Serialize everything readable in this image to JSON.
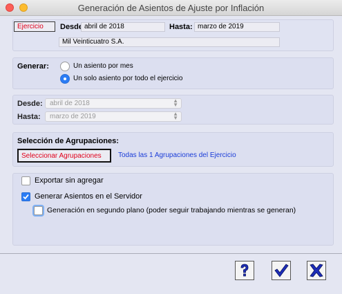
{
  "window": {
    "title": "Generación de Asientos de Ajuste por Inflación"
  },
  "header": {
    "ejercicio_label": "Ejercicio",
    "desde_label": "Desde:",
    "desde_value": "abril de 2018",
    "hasta_label": "Hasta:",
    "hasta_value": "marzo de 2019",
    "company": "Mil Veinticuatro S.A."
  },
  "generar": {
    "label": "Generar:",
    "options": [
      {
        "label": "Un asiento por mes",
        "selected": false
      },
      {
        "label": "Un solo asiento por todo el ejercicio",
        "selected": true
      }
    ]
  },
  "rango": {
    "desde_label": "Desde:",
    "desde_value": "abril de 2018",
    "hasta_label": "Hasta:",
    "hasta_value": "marzo de 2019"
  },
  "agrupaciones": {
    "title": "Selección de Agrupaciones:",
    "button_label": "Seleccionar Agrupaciones",
    "summary_link": "Todas las 1 Agrupaciones del Ejercicio"
  },
  "options": {
    "exportar": {
      "label": "Exportar sin agregar",
      "checked": false
    },
    "servidor": {
      "label": "Generar Asientos en el Servidor",
      "checked": true
    },
    "segundo_plano": {
      "label": "Generación en segundo plano (poder seguir trabajando mientras se generan)",
      "checked": false
    }
  },
  "buttons": {
    "help_icon": "question-icon",
    "ok_icon": "check-icon",
    "cancel_icon": "x-icon"
  },
  "colors": {
    "accent": "#2b7cf5",
    "red_text": "#e0001a",
    "link": "#1a3cd8",
    "background": "#e4e6f2"
  }
}
